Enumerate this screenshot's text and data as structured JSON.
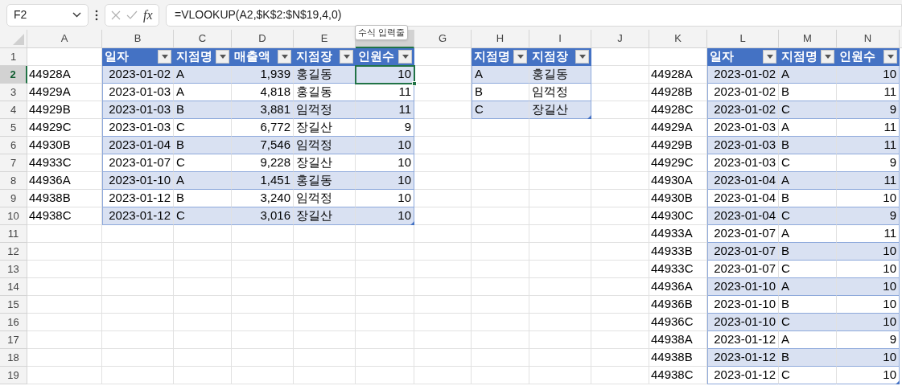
{
  "formula_bar": {
    "name_box": "F2",
    "function_label": "fx",
    "formula": "=VLOOKUP(A2,$K$2:$N$19,4,0)"
  },
  "tooltip": "수식 입력줄",
  "columns": [
    {
      "letter": "A",
      "selected": false
    },
    {
      "letter": "B",
      "selected": false
    },
    {
      "letter": "C",
      "selected": false
    },
    {
      "letter": "D",
      "selected": false
    },
    {
      "letter": "E",
      "selected": false
    },
    {
      "selected": true
    },
    {
      "letter": "G",
      "selected": false
    },
    {
      "letter": "H",
      "selected": false
    },
    {
      "letter": "I",
      "selected": false
    },
    {
      "letter": "J",
      "selected": false
    },
    {
      "letter": "K",
      "selected": false
    },
    {
      "letter": "L",
      "selected": false
    },
    {
      "letter": "M",
      "selected": false
    },
    {
      "letter": "N",
      "selected": false
    }
  ],
  "rows": [
    {
      "number": "1",
      "selected": false
    },
    {
      "number": "2",
      "selected": true
    },
    {
      "number": "3",
      "selected": false
    },
    {
      "number": "4",
      "selected": false
    },
    {
      "number": "5",
      "selected": false
    },
    {
      "number": "6",
      "selected": false
    },
    {
      "number": "7",
      "selected": false
    },
    {
      "number": "8",
      "selected": false
    },
    {
      "number": "9",
      "selected": false
    },
    {
      "number": "10",
      "selected": false
    },
    {
      "number": "11",
      "selected": false
    },
    {
      "number": "12",
      "selected": false
    },
    {
      "number": "13",
      "selected": false
    },
    {
      "number": "14",
      "selected": false
    },
    {
      "number": "15",
      "selected": false
    },
    {
      "number": "16",
      "selected": false
    },
    {
      "number": "17",
      "selected": false
    },
    {
      "number": "18",
      "selected": false
    },
    {
      "number": "19",
      "selected": false
    }
  ],
  "key_columns": [
    [
      "44928A",
      "44929A",
      "44929B",
      "44929C",
      "44930B",
      "44933C",
      "44936A",
      "44938B",
      "44938C"
    ],
    [
      "44928A",
      "44928B",
      "44928C",
      "44929A",
      "44929B",
      "44929C",
      "44930A",
      "44930B",
      "44930C",
      "44933A",
      "44933B",
      "44933C",
      "44936A",
      "44936B",
      "44936C",
      "44938A",
      "44938B",
      "44938C"
    ]
  ],
  "tables": [
    {
      "columns": [
        {
          "label": "일자",
          "numeric": true
        },
        {
          "label": "지점명",
          "numeric": false
        },
        {
          "label": "매출액",
          "numeric": true
        },
        {
          "label": "지점장",
          "numeric": false
        },
        {
          "label": "인원수",
          "numeric": true
        }
      ],
      "rows": [
        [
          "2023-01-02",
          "A",
          "1,939",
          "홍길동",
          "10"
        ],
        [
          "2023-01-03",
          "A",
          "4,818",
          "홍길동",
          "11"
        ],
        [
          "2023-01-03",
          "B",
          "3,881",
          "임꺽정",
          "11"
        ],
        [
          "2023-01-03",
          "C",
          "6,772",
          "장길산",
          "9"
        ],
        [
          "2023-01-04",
          "B",
          "7,546",
          "임꺽정",
          "10"
        ],
        [
          "2023-01-07",
          "C",
          "9,228",
          "장길산",
          "10"
        ],
        [
          "2023-01-10",
          "A",
          "1,451",
          "홍길동",
          "10"
        ],
        [
          "2023-01-12",
          "B",
          "3,240",
          "임꺽정",
          "10"
        ],
        [
          "2023-01-12",
          "C",
          "3,016",
          "장길산",
          "10"
        ]
      ]
    },
    {
      "columns": [
        {
          "label": "지점명",
          "numeric": false
        },
        {
          "label": "지점장",
          "numeric": false
        }
      ],
      "rows": [
        [
          "A",
          "홍길동"
        ],
        [
          "B",
          "임꺽정"
        ],
        [
          "C",
          "장길산"
        ]
      ]
    },
    {
      "columns": [
        {
          "label": "일자",
          "numeric": true
        },
        {
          "label": "지점명",
          "numeric": false
        },
        {
          "label": "인원수",
          "numeric": true
        }
      ],
      "rows": [
        [
          "2023-01-02",
          "A",
          "10"
        ],
        [
          "2023-01-02",
          "B",
          "11"
        ],
        [
          "2023-01-02",
          "C",
          "9"
        ],
        [
          "2023-01-03",
          "A",
          "11"
        ],
        [
          "2023-01-03",
          "B",
          "11"
        ],
        [
          "2023-01-03",
          "C",
          "9"
        ],
        [
          "2023-01-04",
          "A",
          "11"
        ],
        [
          "2023-01-04",
          "B",
          "10"
        ],
        [
          "2023-01-04",
          "C",
          "9"
        ],
        [
          "2023-01-07",
          "A",
          "11"
        ],
        [
          "2023-01-07",
          "B",
          "10"
        ],
        [
          "2023-01-07",
          "C",
          "10"
        ],
        [
          "2023-01-10",
          "A",
          "10"
        ],
        [
          "2023-01-10",
          "B",
          "10"
        ],
        [
          "2023-01-10",
          "C",
          "10"
        ],
        [
          "2023-01-12",
          "A",
          "9"
        ],
        [
          "2023-01-12",
          "B",
          "10"
        ],
        [
          "2023-01-12",
          "C",
          "10"
        ]
      ]
    }
  ]
}
